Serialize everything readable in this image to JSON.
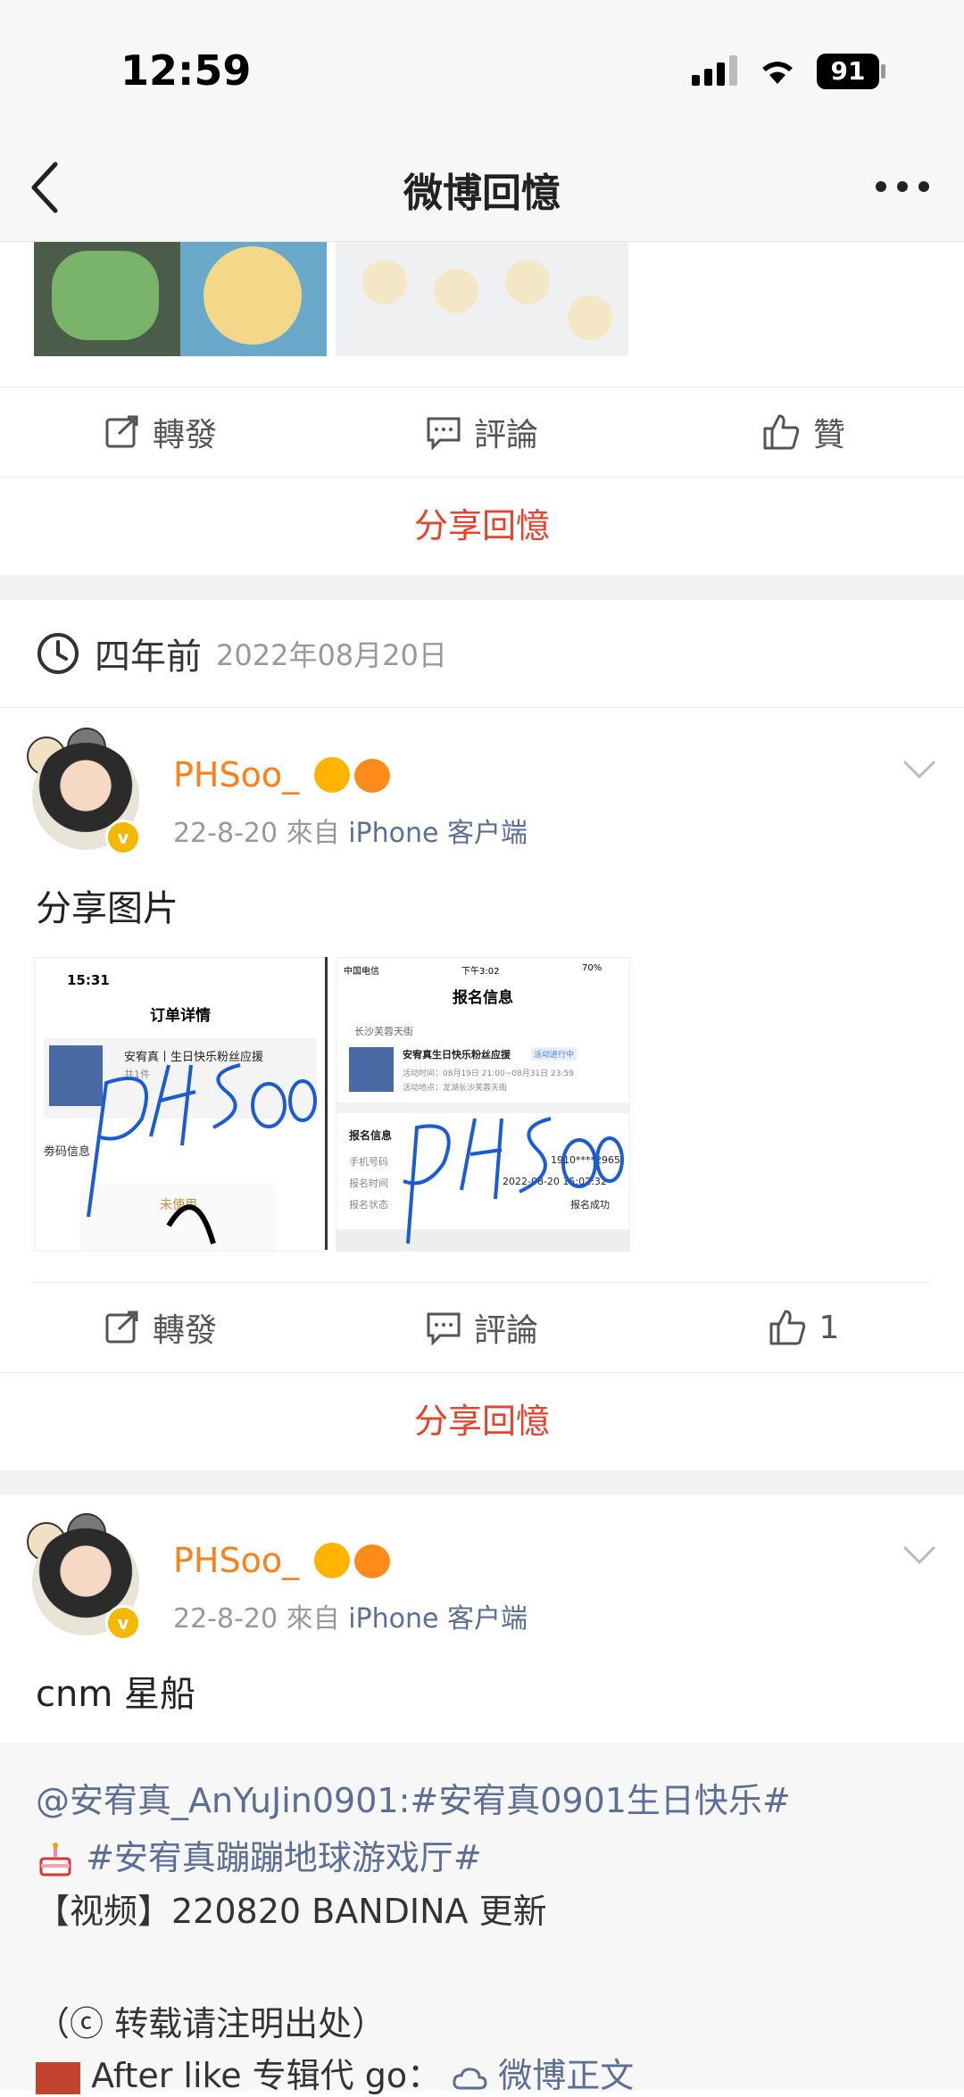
{
  "status": {
    "time": "12:59",
    "battery": "91"
  },
  "nav": {
    "title": "微博回憶"
  },
  "actions1": {
    "repost": "轉發",
    "comment": "評論",
    "like": "贊"
  },
  "share_label": "分享回憶",
  "memory": {
    "ago": "四年前",
    "date": "2022年08月20日"
  },
  "post1": {
    "username": "PHSoo_",
    "time": "22-8-20",
    "from": "來自",
    "source": "iPhone 客户端",
    "text": "分享图片",
    "img1": {
      "time": "15:31",
      "title": "订单详情",
      "item": "安宥真丨生日快乐粉丝应援",
      "qty": "共1件",
      "section": "劵码信息",
      "status": "未使用"
    },
    "img2": {
      "carrier": "中国电信",
      "time": "下午3:02",
      "battery": "70%",
      "title": "报名信息",
      "location": "长沙芙蓉天街",
      "item": "安宥真生日快乐粉丝应援",
      "badge": "活动进行中",
      "activity_time": "活动时间：08月19日 21:00~08月31日 23:59",
      "activity_place": "活动地点：龙湖长沙芙蓉天街",
      "section": "报名信息",
      "row1_label": "手机号码",
      "row1_value": "1910****2965",
      "row2_label": "报名时间",
      "row2_value": "2022-08-20 15:02:32",
      "row3_label": "报名状态",
      "row3_value": "报名成功"
    },
    "actions": {
      "repost": "轉發",
      "comment": "評論",
      "like": "1"
    }
  },
  "post2": {
    "username": "PHSoo_",
    "time": "22-8-20",
    "from": "來自",
    "source": "iPhone 客户端",
    "text": "cnm 星船",
    "quote": {
      "line1": "@安宥真_AnYuJin0901:#安宥真0901生日快乐#",
      "line2": "#安宥真蹦蹦地球游戏厅#",
      "line3": "【视频】220820 BANDINA 更新",
      "line4": "（ⓒ 转载请注明出处）",
      "line5": "After like 专辑代 go：",
      "line5_link": "微博正文"
    }
  },
  "colors": {
    "orange": "#ff7f1a",
    "red": "#e8412c",
    "link": "#5b6e97"
  }
}
